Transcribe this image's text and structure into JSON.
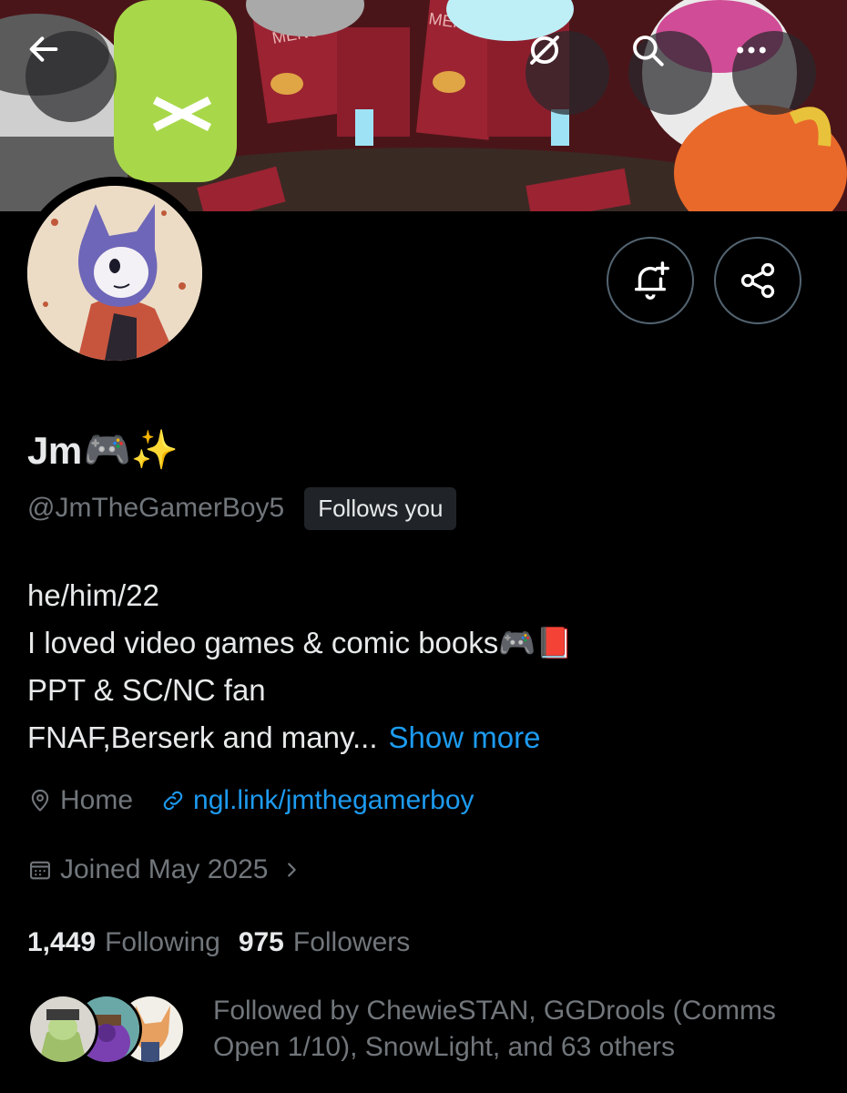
{
  "header": {
    "banner_menu_text_1": "MENU",
    "banner_menu_text_2": "MENU"
  },
  "nav": {
    "back_icon": "arrow-left-icon",
    "grok_icon": "circle-slash-icon",
    "search_icon": "search-icon",
    "more_icon": "more-dots-icon"
  },
  "profile": {
    "display_name": "Jm",
    "display_name_emoji": "🎮✨",
    "handle": "@JmTheGamerBoy5",
    "follows_you_label": "Follows you",
    "bio": {
      "line1": "he/him/22",
      "line2": "I loved video games & comic books",
      "line2_emoji": "🎮📕",
      "line3": "PPT & SC/NC fan",
      "line4": "FNAF,Berserk and many...",
      "show_more": "Show more"
    },
    "location": "Home",
    "website": "ngl.link/jmthegamerboy",
    "joined": "Joined May 2025",
    "following_count": "1,449",
    "following_label": "Following",
    "followers_count": "975",
    "followers_label": "Followers",
    "followed_by": "Followed by ChewieSTAN, GGDrools (Comms Open 1/10), SnowLight, and 63 others"
  },
  "colors": {
    "background": "#000000",
    "text_primary": "#e7e9ea",
    "text_secondary": "#71767b",
    "accent": "#1d9bf0",
    "badge_bg": "#202327"
  }
}
